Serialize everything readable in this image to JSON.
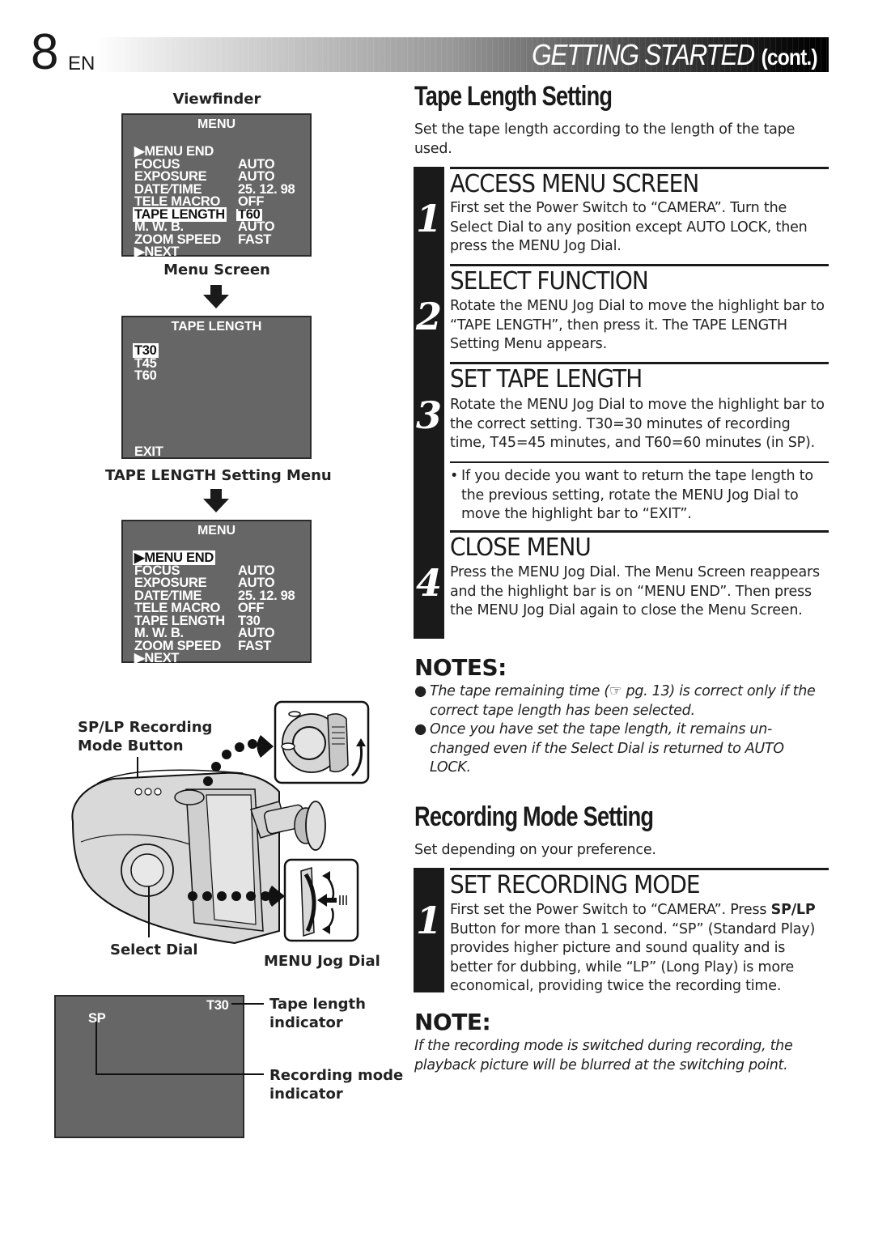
{
  "header": {
    "page_number": "8",
    "language": "EN",
    "title": "GETTING STARTED",
    "title_suffix": "(cont.)"
  },
  "left": {
    "viewfinder_label": "Viewfinder",
    "menu_screen": {
      "title": "MENU",
      "rows": [
        {
          "label": "▶MENU  END",
          "value": ""
        },
        {
          "label": "FOCUS",
          "value": "AUTO"
        },
        {
          "label": "EXPOSURE",
          "value": "AUTO"
        },
        {
          "label": "DATE⁄TIME",
          "value": "25. 12. 98"
        },
        {
          "label": "TELE  MACRO",
          "value": "OFF"
        },
        {
          "label": "TAPE  LENGTH",
          "value": "T60"
        },
        {
          "label": "M. W. B.",
          "value": "AUTO"
        },
        {
          "label": "ZOOM SPEED",
          "value": "FAST"
        },
        {
          "label": "▶NEXT",
          "value": ""
        }
      ],
      "highlighted_row": "TAPE  LENGTH",
      "caption": "Menu Screen"
    },
    "tape_length_screen": {
      "title": "TAPE  LENGTH",
      "options": [
        "T30",
        "T45",
        "T60"
      ],
      "highlighted_option": "T30",
      "exit_label": "EXIT",
      "caption": "TAPE LENGTH Setting Menu"
    },
    "menu_screen_after": {
      "title": "MENU",
      "rows": [
        {
          "label": "▶MENU  END",
          "value": ""
        },
        {
          "label": "FOCUS",
          "value": "AUTO"
        },
        {
          "label": "EXPOSURE",
          "value": "AUTO"
        },
        {
          "label": "DATE⁄TIME",
          "value": "25. 12. 98"
        },
        {
          "label": "TELE  MACRO",
          "value": "OFF"
        },
        {
          "label": "TAPE  LENGTH",
          "value": "T30"
        },
        {
          "label": "M. W. B.",
          "value": "AUTO"
        },
        {
          "label": "ZOOM SPEED",
          "value": "FAST"
        },
        {
          "label": "▶NEXT",
          "value": ""
        }
      ],
      "highlighted_row": "▶MENU  END"
    },
    "camera_illustration": {
      "sp_lp_label_line1": "SP/LP Recording",
      "sp_lp_label_line2": "Mode Button",
      "select_dial_label": "Select Dial",
      "menu_jog_dial_label": "MENU Jog Dial"
    },
    "display_screen": {
      "tape_indicator": "T30",
      "mode_indicator": "SP",
      "tape_callout_line1": "Tape length",
      "tape_callout_line2": "indicator",
      "mode_callout_line1": "Recording mode",
      "mode_callout_line2": "indicator"
    }
  },
  "tape_length_setting": {
    "title": "Tape Length Setting",
    "intro": "Set the tape length according to the length of the tape used.",
    "steps": [
      {
        "number": "1",
        "heading": "ACCESS MENU SCREEN",
        "text": "First set the Power Switch to “CAMERA”. Turn the Select Dial to any position except AUTO LOCK, then press the MENU Jog Dial."
      },
      {
        "number": "2",
        "heading": "SELECT FUNCTION",
        "text": "Rotate the MENU Jog Dial to move the highlight bar to “TAPE LENGTH”, then press it. The TAPE LENGTH Setting Menu appears."
      },
      {
        "number": "3",
        "heading": "SET TAPE LENGTH",
        "text": "Rotate the MENU Jog Dial to move the highlight bar to the correct setting. T30=30 minutes of recording time, T45=45 minutes, and T60=60 minutes (in SP).",
        "bullet": "If  you decide you want to return the tape length to the previous setting, rotate the MENU Jog Dial to move the highlight bar to “EXIT”."
      },
      {
        "number": "4",
        "heading": "CLOSE MENU",
        "text": "Press the MENU Jog Dial. The Menu Screen reappears and the highlight bar is on “MENU END”. Then press the MENU Jog Dial again to close the Menu Screen."
      }
    ],
    "notes_heading": "NOTES:",
    "notes": [
      "The tape remaining time (☞ pg. 13) is correct only if the correct tape length has been selected.",
      "Once you have set the tape length, it remains un-changed even if the Select Dial is returned to AUTO LOCK."
    ]
  },
  "recording_mode_setting": {
    "title": "Recording Mode Setting",
    "intro": "Set depending on your preference.",
    "step": {
      "number": "1",
      "heading": "SET RECORDING MODE",
      "text_before": "First set the Power Switch to “CAMERA”. Press ",
      "text_bold": "SP/LP",
      "text_after": " Button for more than 1 second. “SP” (Standard Play) provides higher picture and sound quality and is better for dubbing, while “LP” (Long Play) is more economical, providing twice the recording time."
    },
    "note_heading": "NOTE:",
    "note": "If the recording mode is switched during recording, the playback picture will be blurred at the switching point."
  }
}
